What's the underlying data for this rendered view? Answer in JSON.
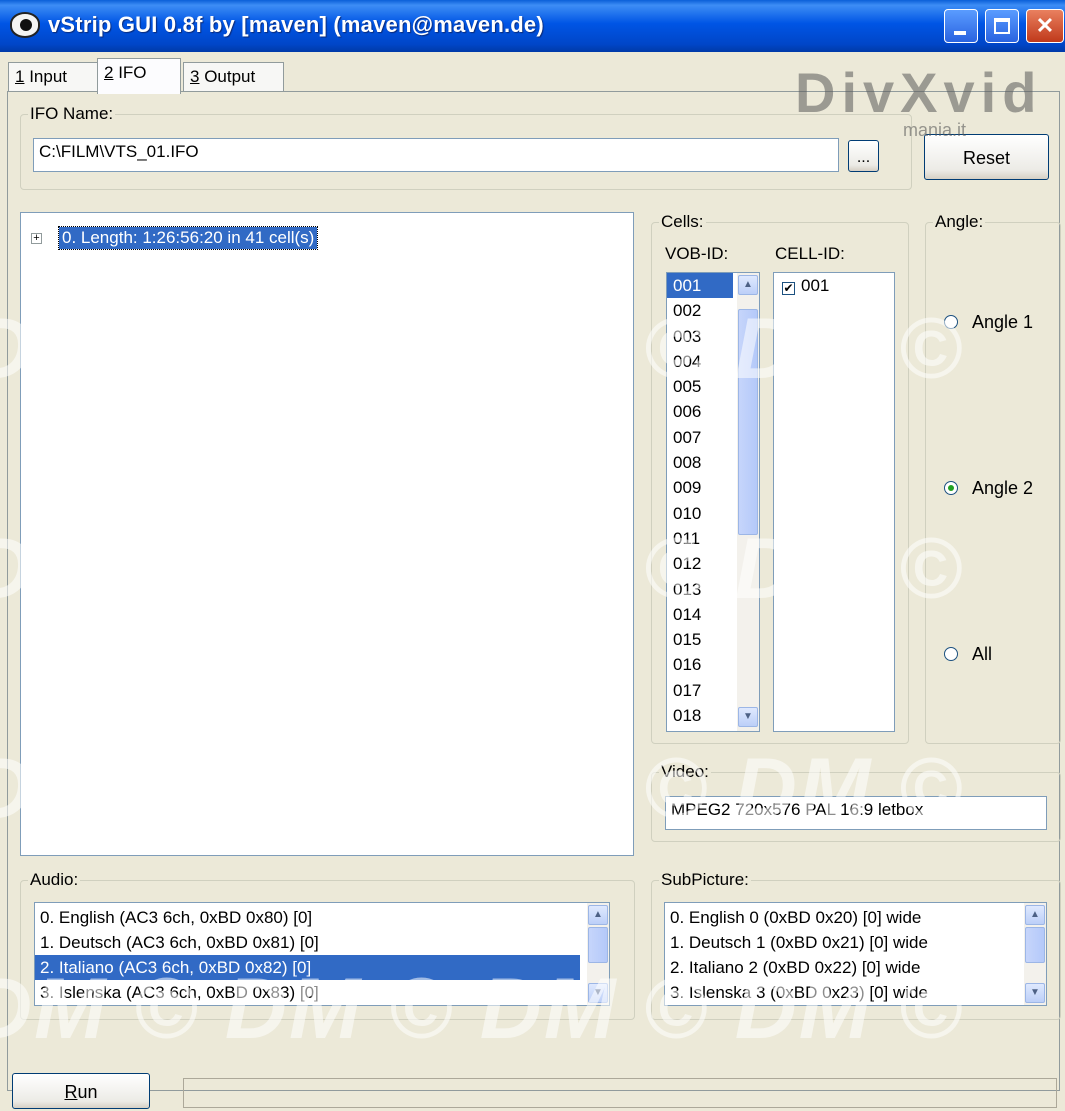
{
  "window": {
    "title": "vStrip GUI 0.8f by [maven] (maven@maven.de)"
  },
  "watermark": {
    "text": "DM © DM © DM © DM ©",
    "logo": "DivXvid",
    "logo_sub": "mania.it"
  },
  "tabs": [
    {
      "hotkey": "1",
      "label": " Input",
      "active": false
    },
    {
      "hotkey": "2",
      "label": " IFO",
      "active": true
    },
    {
      "hotkey": "3",
      "label": " Output",
      "active": false
    }
  ],
  "ifo": {
    "legend": "IFO Name:",
    "path": "C:\\FILM\\VTS_01.IFO",
    "browse_label": "...",
    "reset_label": "Reset"
  },
  "tree": {
    "expander": "+",
    "node": "0. Length: 1:26:56:20 in 41 cell(s)"
  },
  "cells": {
    "legend": "Cells:",
    "vob_header": "VOB-ID:",
    "cell_header": "CELL-ID:",
    "vob_ids": [
      "001",
      "002",
      "003",
      "004",
      "005",
      "006",
      "007",
      "008",
      "009",
      "010",
      "011",
      "012",
      "013",
      "014",
      "015",
      "016",
      "017",
      "018"
    ],
    "selected_vob": "001",
    "cell_ids": [
      {
        "label": "001",
        "checked": true
      }
    ]
  },
  "angle": {
    "legend": "Angle:",
    "options": [
      {
        "label": "Angle 1",
        "selected": false
      },
      {
        "label": "Angle 2",
        "selected": true
      },
      {
        "label": "All",
        "selected": false
      }
    ]
  },
  "video": {
    "legend": "Video:",
    "value": "MPEG2 720x576 PAL 16:9 letbox"
  },
  "audio": {
    "legend": "Audio:",
    "items": [
      "0. English (AC3 6ch, 0xBD 0x80) [0]",
      "1. Deutsch (AC3 6ch, 0xBD 0x81) [0]",
      "2. Italiano (AC3 6ch, 0xBD 0x82) [0]",
      "3. Islenska (AC3 6ch, 0xBD 0x83) [0]"
    ],
    "selected_index": 2
  },
  "subpicture": {
    "legend": "SubPicture:",
    "items": [
      "0. English 0 (0xBD 0x20) [0] wide",
      "1. Deutsch 1 (0xBD 0x21) [0] wide",
      "2. Italiano 2 (0xBD 0x22) [0] wide",
      "3. Islenska 3 (0xBD 0x23) [0] wide"
    ]
  },
  "footer": {
    "run_hotkey": "R",
    "run_rest": "un",
    "status": ""
  },
  "icons": {
    "minimize": "minimize-icon",
    "maximize": "maximize-icon",
    "close": "close-icon",
    "app": "eye-icon"
  },
  "colors": {
    "titlebar": "#0055e5",
    "selection": "#316ac5",
    "face": "#ece9d8"
  }
}
